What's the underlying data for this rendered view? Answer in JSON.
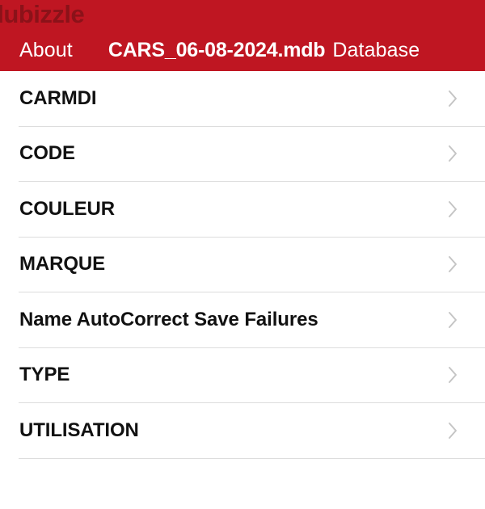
{
  "header": {
    "watermark": "dubizzle",
    "back_label": "About",
    "title_file": "CARS_06-08-2024.mdb",
    "title_suffix": "Database",
    "background_color": "#bf1622",
    "watermark_color": "#8b1219",
    "text_color": "#ffffff"
  },
  "list": {
    "chevron_color": "#c4c4c4",
    "separator_color": "#dddddd",
    "label_color": "#111111",
    "items": [
      {
        "label": "CARMDI",
        "accessory": "chevron-right-icon"
      },
      {
        "label": "CODE",
        "accessory": "chevron-right-icon"
      },
      {
        "label": "COULEUR",
        "accessory": "chevron-right-icon"
      },
      {
        "label": "MARQUE",
        "accessory": "chevron-right-icon"
      },
      {
        "label": "Name AutoCorrect Save Failures",
        "accessory": "chevron-right-icon"
      },
      {
        "label": "TYPE",
        "accessory": "chevron-right-icon"
      },
      {
        "label": "UTILISATION",
        "accessory": "chevron-right-icon"
      }
    ]
  }
}
